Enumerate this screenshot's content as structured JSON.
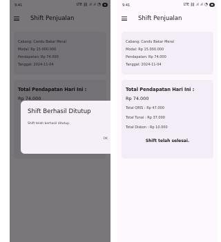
{
  "status_bar": {
    "time": "9:41",
    "indicators": "LTE ⛓ .ıl .ıl",
    "wifi_icon": "wifi-icon",
    "battery_icon": "battery-icon"
  },
  "app_bar": {
    "title": "Shift Penjualan",
    "menu_icon": "menu-icon"
  },
  "shift_info": {
    "cabang": "Cabang: Candu Bakar Meral",
    "modal": "Modal: Rp 15.000.000",
    "pendapatan": "Pendapatan: Rp 74.000",
    "tanggal": "Tanggal: 2024-11-04"
  },
  "summary": {
    "heading": "Total Pendapatan Hari Ini :",
    "total": "Rp 74.000",
    "qris": "Total QRIS : Rp 47.000",
    "tunai": "Total Tunai : Rp 37.000",
    "diskon": "Total Diskon : Rp 10.000",
    "closed_message": "Shift telah selesai."
  },
  "dialog": {
    "title": "Shift Berhasil Ditutup",
    "message": "Shift telah berhasil ditutup.",
    "ok_label": "OK"
  },
  "colors": {
    "background": "#fdf8fd",
    "card": "#f3edf7",
    "scrim": "rgba(0,0,0,0.52)"
  }
}
